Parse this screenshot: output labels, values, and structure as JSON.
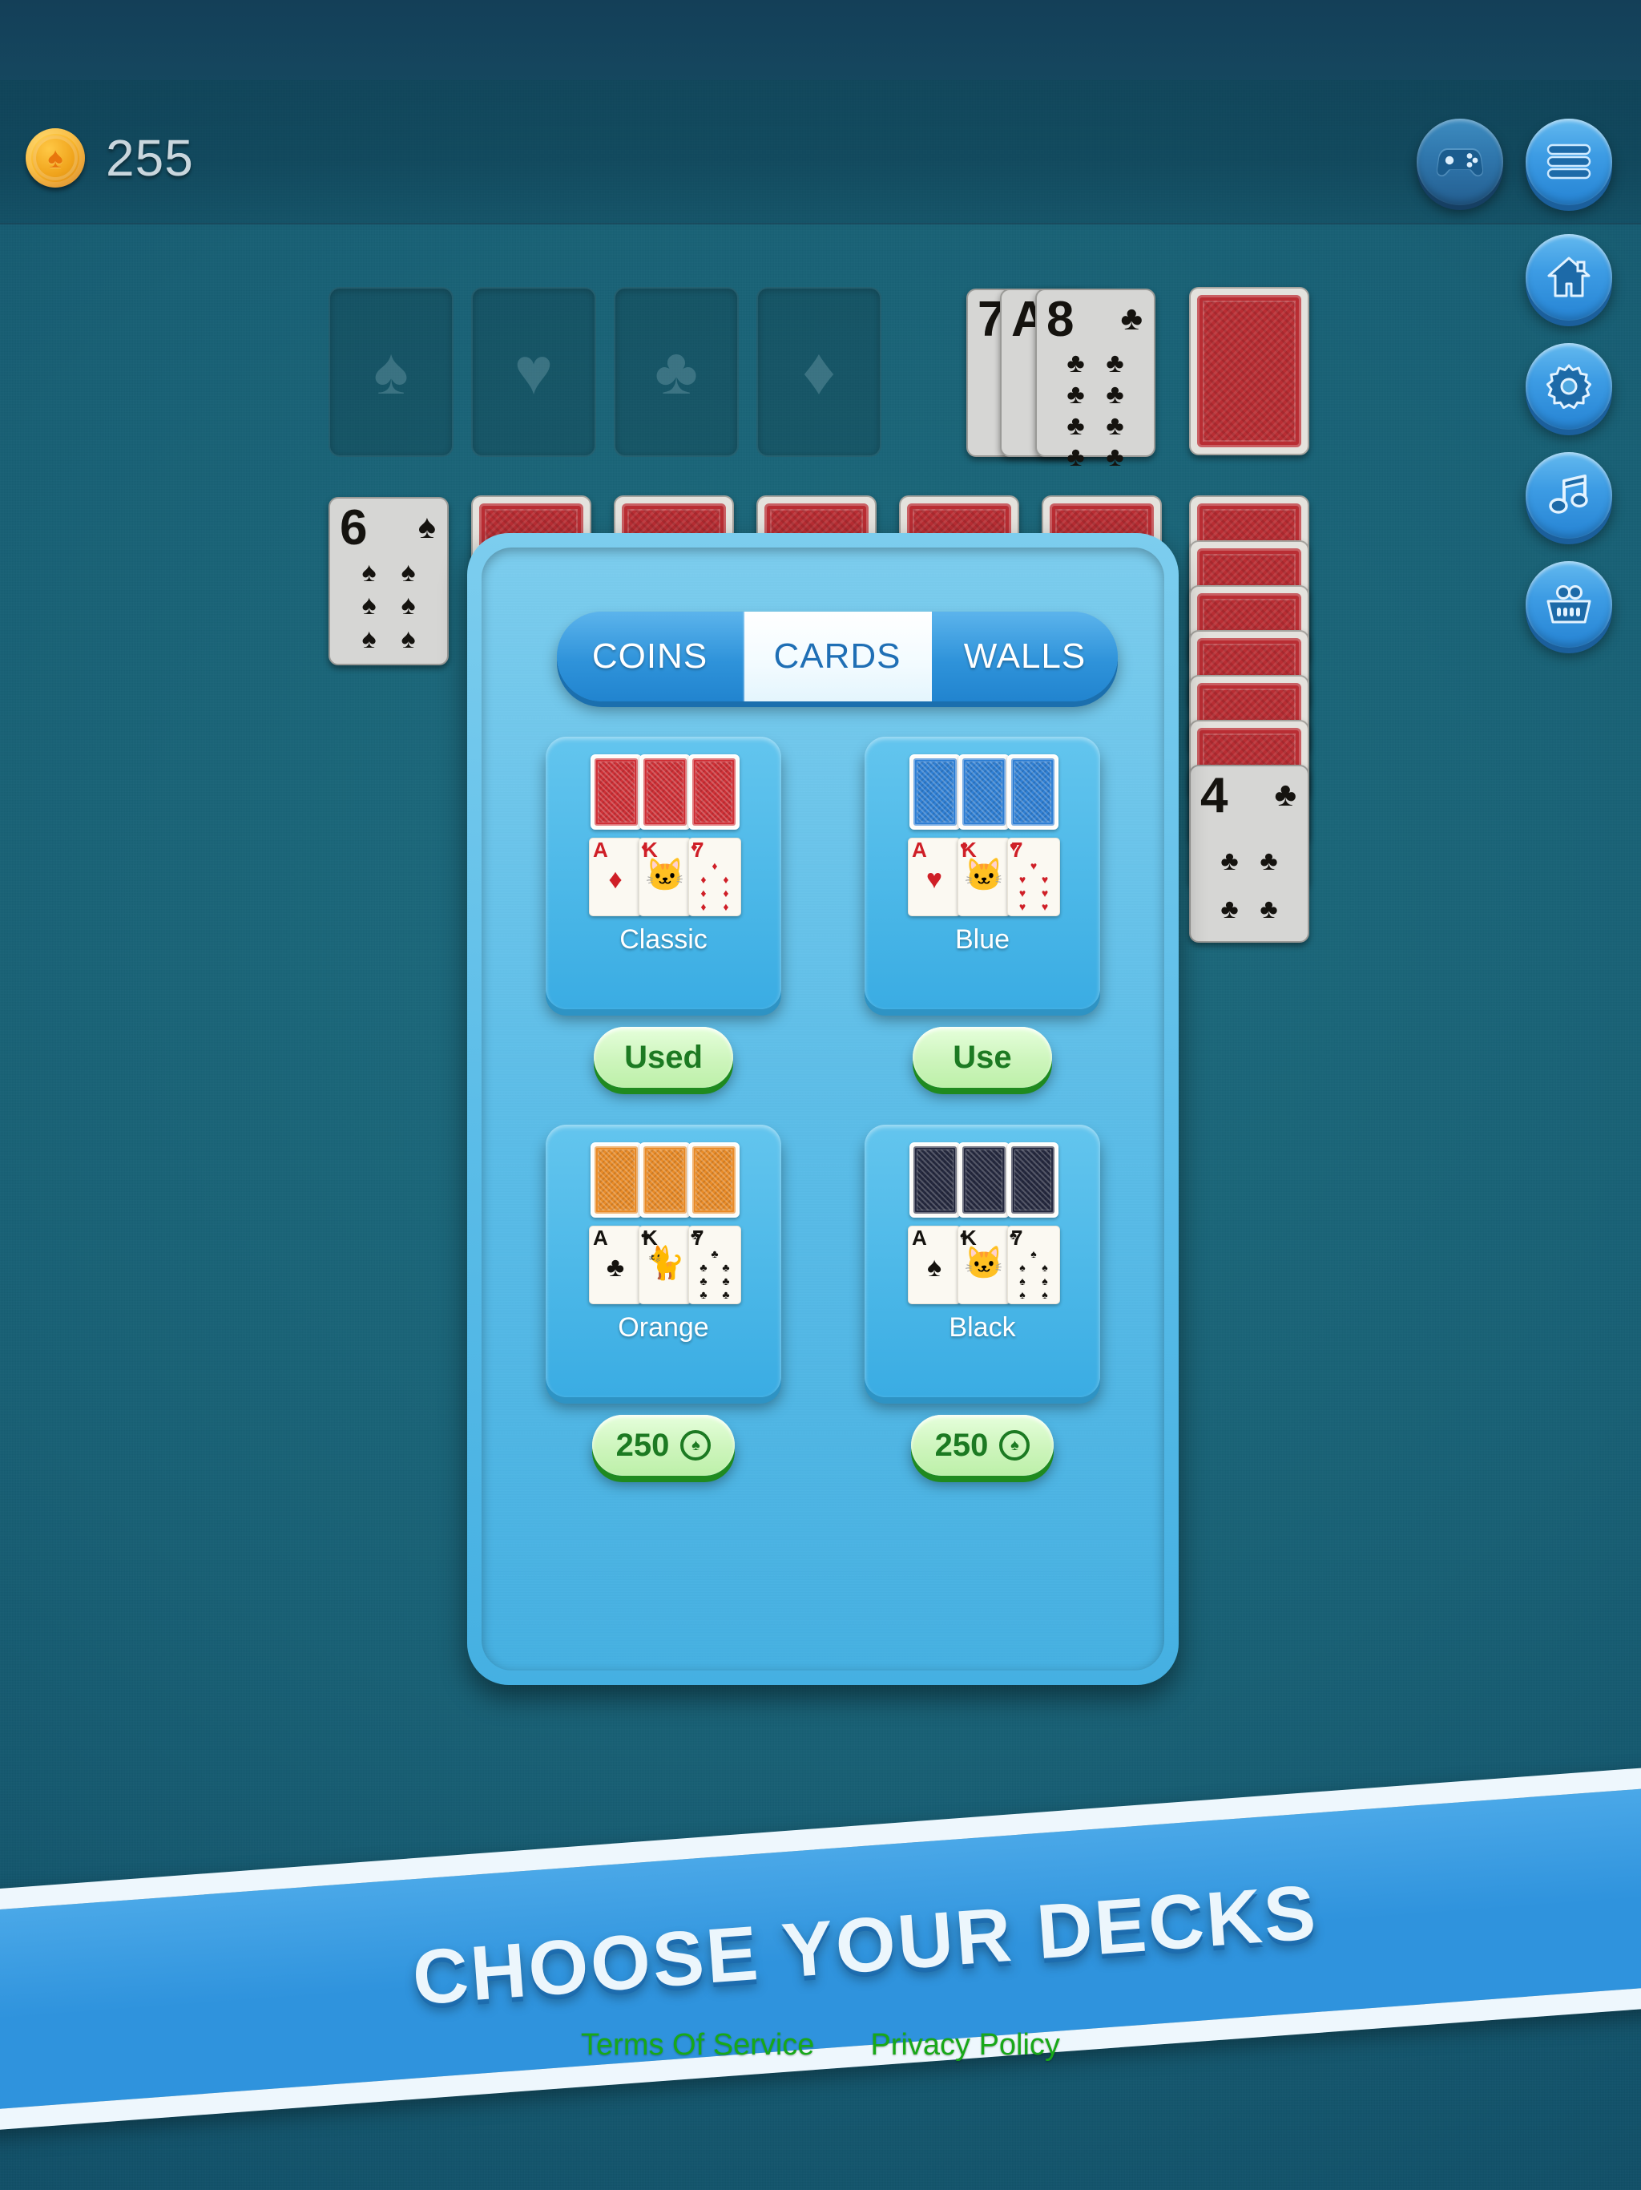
{
  "status_bar": {
    "coin_icon": "coin-spade-icon",
    "coin_count": "255"
  },
  "nav": {
    "top_right": [
      {
        "name": "gamepad-button",
        "icon": "gamepad-icon"
      },
      {
        "name": "menu-button",
        "icon": "hamburger-menu-icon"
      }
    ],
    "side": [
      {
        "name": "home-button",
        "icon": "home-icon"
      },
      {
        "name": "settings-button",
        "icon": "gear-icon"
      },
      {
        "name": "music-button",
        "icon": "music-note-icon"
      },
      {
        "name": "shop-button",
        "icon": "shopping-basket-icon"
      }
    ]
  },
  "board": {
    "foundations": [
      {
        "suit": "spade",
        "glyph": "♠"
      },
      {
        "suit": "heart",
        "glyph": "♥"
      },
      {
        "suit": "club",
        "glyph": "♣"
      },
      {
        "suit": "diamond",
        "glyph": "♦"
      }
    ],
    "waste": [
      {
        "rank": "7",
        "suit": "",
        "glyph": ""
      },
      {
        "rank": "A",
        "suit": "",
        "glyph": ""
      },
      {
        "rank": "8",
        "suit": "club",
        "glyph": "♣"
      }
    ],
    "stock": {
      "name": "stock-pile",
      "facedown": true
    },
    "tableau_left": {
      "rank": "6",
      "suit": "spade",
      "glyph": "♠"
    },
    "tableau_right": {
      "rank": "4",
      "suit": "club",
      "glyph": "♣",
      "facedown_count": 6
    },
    "facedown_row_count": 5
  },
  "modal": {
    "tabs": [
      {
        "label": "COINS",
        "active": false
      },
      {
        "label": "CARDS",
        "active": true
      },
      {
        "label": "WALLS",
        "active": false
      }
    ],
    "decks": [
      {
        "name": "Classic",
        "back_color": "#cf3036",
        "action_label": "Used",
        "action_type": "used",
        "suit_glyph": "♦",
        "suit_class": "red",
        "faces": [
          {
            "rank": "A",
            "kind": "ace"
          },
          {
            "rank": "K",
            "kind": "king"
          },
          {
            "rank": "7",
            "kind": "pips"
          }
        ]
      },
      {
        "name": "Blue",
        "back_color": "#2f7fd4",
        "action_label": "Use",
        "action_type": "use",
        "suit_glyph": "♥",
        "suit_class": "red",
        "faces": [
          {
            "rank": "A",
            "kind": "ace"
          },
          {
            "rank": "K",
            "kind": "king"
          },
          {
            "rank": "7",
            "kind": "pips"
          }
        ]
      },
      {
        "name": "Orange",
        "back_color": "#e98b27",
        "action_label": "250",
        "action_type": "price",
        "price_icon": "coin-spade-icon",
        "suit_glyph": "♣",
        "suit_class": "blk",
        "faces": [
          {
            "rank": "A",
            "kind": "ace"
          },
          {
            "rank": "K",
            "kind": "king"
          },
          {
            "rank": "7",
            "kind": "pips"
          }
        ]
      },
      {
        "name": "Black",
        "back_color": "#25293f",
        "action_label": "250",
        "action_type": "price",
        "price_icon": "coin-spade-icon",
        "suit_glyph": "♠",
        "suit_class": "blk",
        "faces": [
          {
            "rank": "A",
            "kind": "ace"
          },
          {
            "rank": "K",
            "kind": "king"
          },
          {
            "rank": "7",
            "kind": "pips"
          }
        ]
      }
    ]
  },
  "banner": {
    "title": "CHOOSE YOUR DECKS"
  },
  "legal": {
    "terms_label": "Terms Of Service",
    "privacy_label": "Privacy Policy"
  },
  "colors": {
    "accent_blue": "#2f93dd",
    "panel_border": "#5cbde8",
    "modal_bg": "#19757f",
    "felt": "#186075",
    "action_green_bg": "#cdf5bc",
    "action_green_text": "#1c7a22",
    "coin_gold": "#f7b42a",
    "link_green": "#18a818"
  }
}
